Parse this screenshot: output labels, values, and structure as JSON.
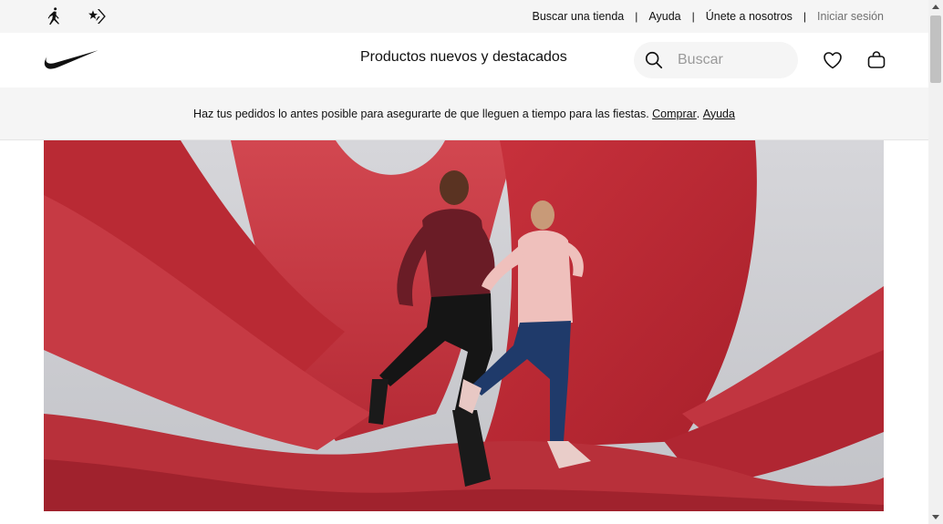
{
  "brand_icons": [
    "jordan-icon",
    "converse-icon"
  ],
  "utility": {
    "links": [
      {
        "label": "Buscar una tienda"
      },
      {
        "label": "Ayuda"
      },
      {
        "label": "Únete a nosotros"
      },
      {
        "label": "Iniciar sesión"
      }
    ],
    "separator": "|"
  },
  "nav": {
    "logo": "nike-swoosh-icon",
    "title": "Productos nuevos y destacados",
    "search_placeholder": "Buscar",
    "icons": [
      "heart-icon",
      "bag-icon"
    ]
  },
  "promo": {
    "text": "Haz tus pedidos lo antes posible para asegurarte de que lleguen a tiempo para las fiestas.",
    "link_shop": "Comprar",
    "link_help": "Ayuda"
  },
  "hero": {
    "description_icon": "hero-image"
  },
  "colors": {
    "accent_red": "#c4323c",
    "light_gray": "#f5f5f5",
    "text": "#111111"
  }
}
